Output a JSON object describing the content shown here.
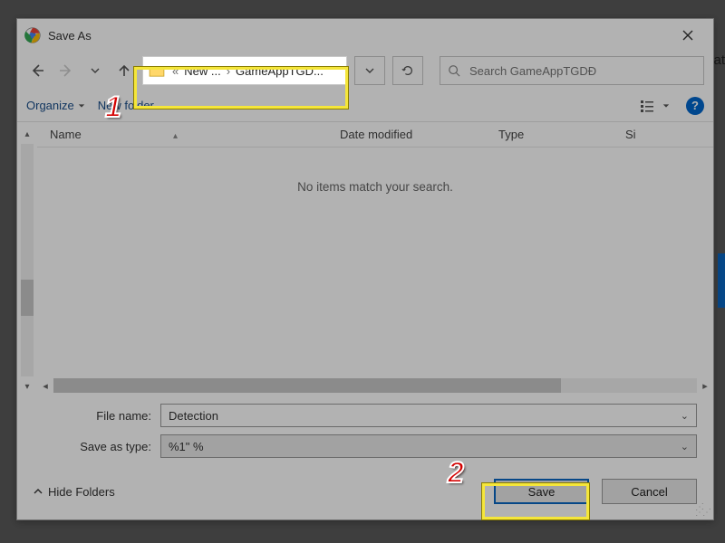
{
  "window": {
    "title": "Save As"
  },
  "nav": {
    "breadcrumb": {
      "sep1": "«",
      "seg1": "New ...",
      "sep2": "›",
      "seg2": "GameAppTGD..."
    },
    "search_placeholder": "Search GameAppTGDĐ"
  },
  "toolbar": {
    "organize": "Organize",
    "newfolder": "New folder"
  },
  "columns": {
    "name": "Name",
    "date": "Date modified",
    "type": "Type",
    "size": "Si"
  },
  "list": {
    "empty": "No items match your search."
  },
  "fields": {
    "filename_label": "File name:",
    "filename_value": "Detection",
    "type_label": "Save as type:",
    "type_value": "%1\" %"
  },
  "footer": {
    "hide_folders": "Hide Folders",
    "save": "Save",
    "cancel": "Cancel"
  },
  "annotations": {
    "step1": "1",
    "step2": "2"
  },
  "bg": {
    "peek": "lat"
  }
}
